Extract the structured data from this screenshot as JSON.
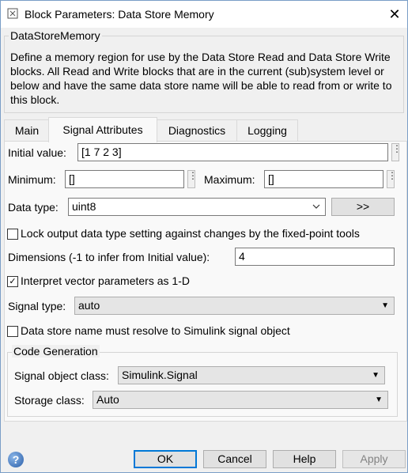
{
  "window": {
    "title": "Block Parameters: Data Store Memory",
    "close_glyph": "✕"
  },
  "block": {
    "group_label": "DataStoreMemory",
    "description": "Define a memory region for use by the Data Store Read and Data Store Write blocks. All Read and Write blocks that are in the current (sub)system level or below and have the same data store name will be able to read from or write to this block."
  },
  "tabs": [
    {
      "label": "Main"
    },
    {
      "label": "Signal Attributes"
    },
    {
      "label": "Diagnostics"
    },
    {
      "label": "Logging"
    }
  ],
  "fields": {
    "initial_value_label": "Initial value:",
    "initial_value": "[1 7 2 3]",
    "minimum_label": "Minimum:",
    "minimum_value": "[]",
    "maximum_label": "Maximum:",
    "maximum_value": "[]",
    "data_type_label": "Data type:",
    "data_type_value": "uint8",
    "data_type_assistant": ">>",
    "lock_label": "Lock output data type setting against changes by the fixed-point tools",
    "lock_checked": "",
    "dimensions_label": "Dimensions (-1 to infer from Initial value):",
    "dimensions_value": "4",
    "interpret_label": "Interpret vector parameters as 1-D",
    "interpret_checked": "✓",
    "signal_type_label": "Signal type:",
    "signal_type_value": "auto",
    "resolve_label": "Data store name must resolve to Simulink signal object",
    "resolve_checked": ""
  },
  "code_generation": {
    "group_label": "Code Generation",
    "signal_object_class_label": "Signal object class:",
    "signal_object_class_value": "Simulink.Signal",
    "storage_class_label": "Storage class:",
    "storage_class_value": "Auto"
  },
  "buttons": {
    "ok": "OK",
    "cancel": "Cancel",
    "help": "Help",
    "apply": "Apply",
    "help_icon_glyph": "?"
  },
  "glyphs": {
    "combo_arrow": "▼",
    "dots": "⋮"
  }
}
